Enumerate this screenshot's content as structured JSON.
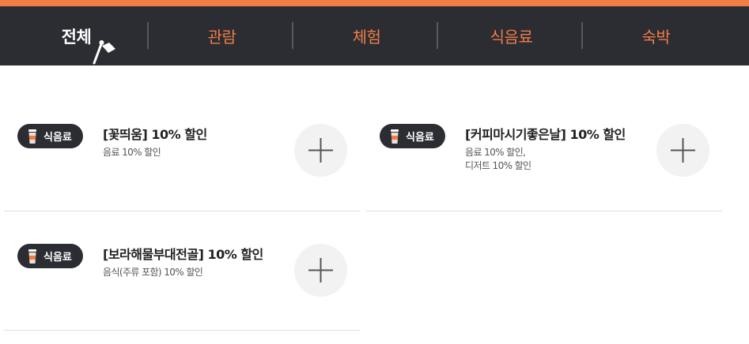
{
  "colors": {
    "accent": "#f07d46",
    "tabbar_bg": "#2b2d33",
    "badge_bg": "#2b2d33",
    "plus_bg": "#f2f2f2"
  },
  "tabs": [
    {
      "label": "전체",
      "active": true
    },
    {
      "label": "관람",
      "active": false
    },
    {
      "label": "체험",
      "active": false
    },
    {
      "label": "식음료",
      "active": false
    },
    {
      "label": "숙박",
      "active": false
    }
  ],
  "cards": [
    {
      "category": "식음료",
      "category_icon": "coffee-cup-icon",
      "title": "[꽃띄움] 10% 할인",
      "desc": [
        "음료 10% 할인"
      ],
      "action_icon": "plus-icon"
    },
    {
      "category": "식음료",
      "category_icon": "coffee-cup-icon",
      "title": "[커피마시기좋은날] 10% 할인",
      "desc": [
        "음료 10% 할인,",
        "디저트 10% 할인"
      ],
      "action_icon": "plus-icon"
    },
    {
      "category": "식음료",
      "category_icon": "coffee-cup-icon",
      "title": "[보라해물부대전골] 10% 할인",
      "desc": [
        "음식(주류 포함) 10% 할인"
      ],
      "action_icon": "plus-icon"
    }
  ]
}
